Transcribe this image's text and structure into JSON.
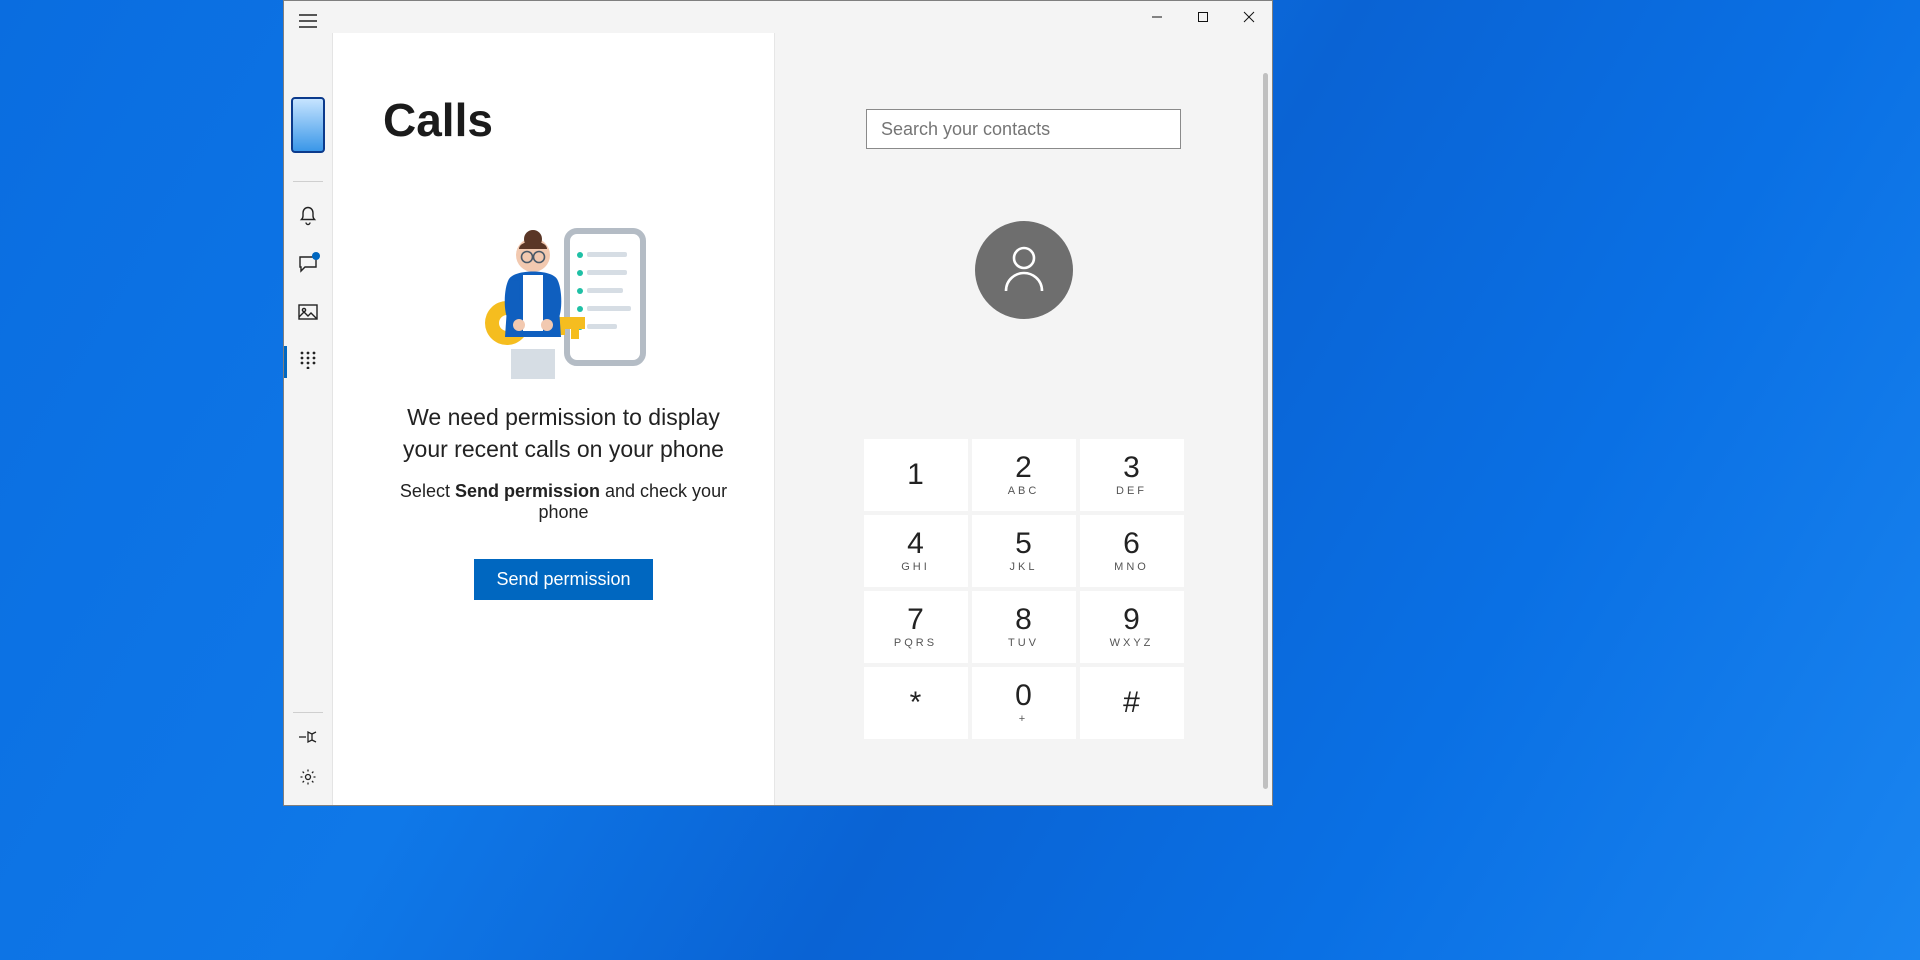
{
  "page": {
    "title": "Calls"
  },
  "hero": {
    "heading": "We need permission to display your recent calls on your phone",
    "sub_pre": "Select ",
    "sub_bold": "Send permission",
    "sub_post": " and check your phone",
    "button": "Send permission"
  },
  "search": {
    "placeholder": "Search your contacts"
  },
  "dialpad": [
    {
      "digit": "1",
      "letters": ""
    },
    {
      "digit": "2",
      "letters": "ABC"
    },
    {
      "digit": "3",
      "letters": "DEF"
    },
    {
      "digit": "4",
      "letters": "GHI"
    },
    {
      "digit": "5",
      "letters": "JKL"
    },
    {
      "digit": "6",
      "letters": "MNO"
    },
    {
      "digit": "7",
      "letters": "PQRS"
    },
    {
      "digit": "8",
      "letters": "TUV"
    },
    {
      "digit": "9",
      "letters": "WXYZ"
    },
    {
      "digit": "*",
      "letters": ""
    },
    {
      "digit": "0",
      "letters": "+"
    },
    {
      "digit": "#",
      "letters": ""
    }
  ]
}
